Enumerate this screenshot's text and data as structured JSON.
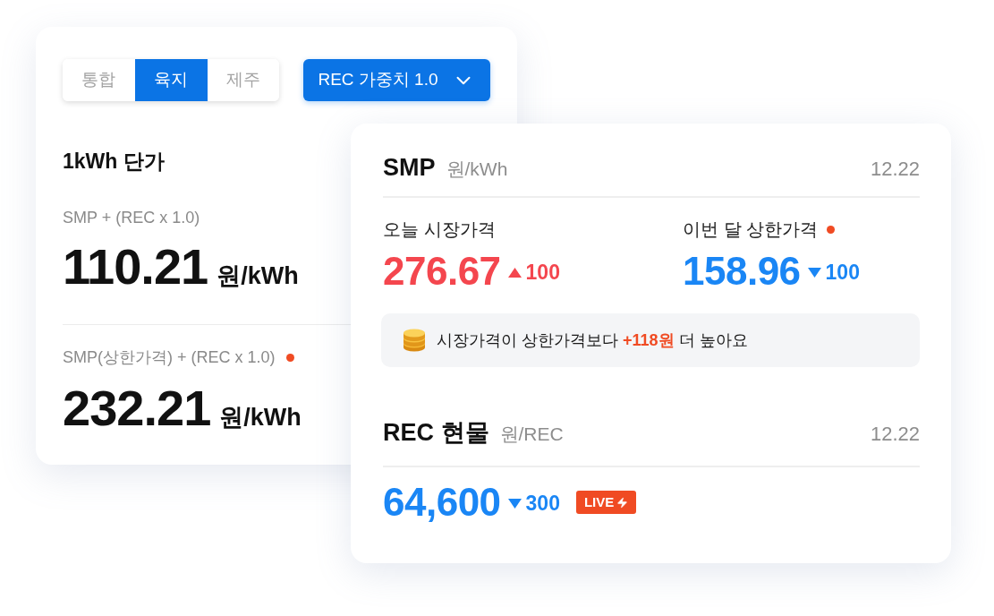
{
  "rate_card": {
    "tabs": [
      {
        "label": "통합",
        "selected": false
      },
      {
        "label": "육지",
        "selected": true
      },
      {
        "label": "제주",
        "selected": false
      }
    ],
    "weight_dropdown": {
      "label": "REC 가중치 1.0"
    },
    "title": "1kWh 단가",
    "rows": [
      {
        "formula": "SMP + (REC x 1.0)",
        "notice_dot": false,
        "value": "110.21",
        "unit": "원/kWh"
      },
      {
        "formula": "SMP(상한가격) + (REC x 1.0)",
        "notice_dot": true,
        "value": "232.21",
        "unit": "원/kWh"
      }
    ]
  },
  "market_card": {
    "smp": {
      "title": "SMP",
      "unit": "원/kWh",
      "date": "12.22",
      "prices": [
        {
          "label": "오늘 시장가격",
          "notice_dot": false,
          "value": "276.67",
          "change": {
            "rising": true,
            "value": "100"
          }
        },
        {
          "label": "이번 달 상한가격",
          "notice_dot": true,
          "value": "158.96",
          "change": {
            "rising": false,
            "value": "100"
          }
        }
      ],
      "note": {
        "before": "시장가격이 상한가격보다",
        "highlight": "+118원",
        "after": "더 높아요"
      }
    },
    "rec": {
      "title": "REC 현물",
      "unit": "원/REC",
      "date": "12.22",
      "price": {
        "value": "64,600",
        "change": {
          "rising": false,
          "value": "300"
        }
      },
      "badge": {
        "label": "LIVE"
      }
    }
  }
}
